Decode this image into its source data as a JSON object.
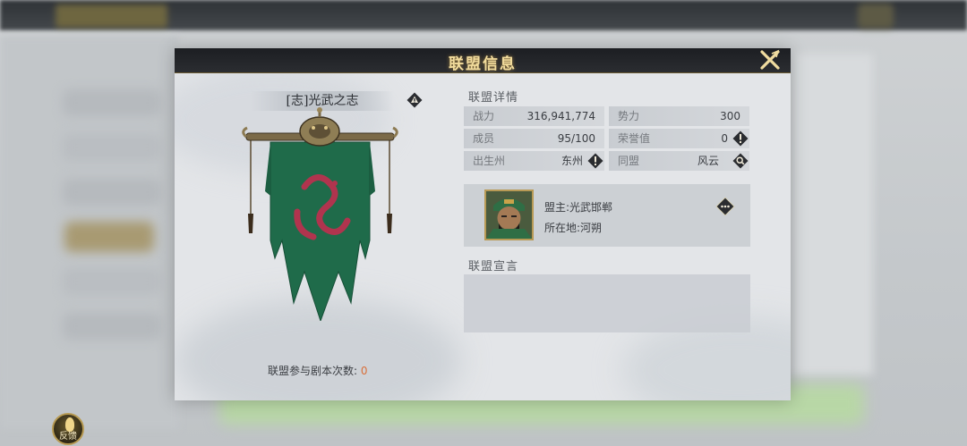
{
  "modal": {
    "title": "联盟信息"
  },
  "banner": {
    "alliance_name": "[志]光武之志",
    "dungeon_count_label": "联盟参与剧本次数:",
    "dungeon_count_value": "0",
    "flag_color": "#1f6b4a",
    "emblem_color": "#b0344e"
  },
  "details": {
    "section_title": "联盟详情",
    "stats": [
      {
        "label": "战力",
        "value": "316,941,774"
      },
      {
        "label": "势力",
        "value": "300"
      },
      {
        "label": "成员",
        "value": "95/100"
      },
      {
        "label": "荣誉值",
        "value": "0",
        "icon": "exclamation-icon"
      },
      {
        "label": "出生州",
        "value": "东州",
        "icon": "exclamation-icon"
      },
      {
        "label": "同盟",
        "value": "风云",
        "icon": "search-icon"
      }
    ]
  },
  "leader": {
    "leader_line": "盟主:光武邯郸",
    "location_line": "所在地:河朔",
    "more_icon": "more-icon"
  },
  "manifesto": {
    "section_title": "联盟宣言",
    "text": ""
  },
  "footer": {
    "feedback_label": "反馈"
  },
  "colors": {
    "title_gold": "#f2dc9c",
    "count_orange": "#d9703a",
    "icon_dark": "#2a2c30"
  }
}
